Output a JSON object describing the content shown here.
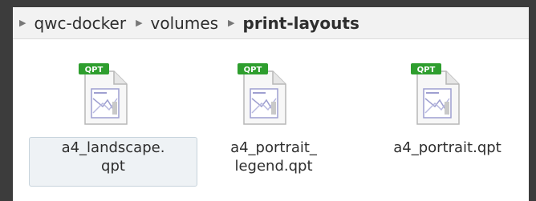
{
  "breadcrumb": {
    "items": [
      "qwc-docker",
      "volumes"
    ],
    "current": "print-layouts"
  },
  "files": [
    {
      "name": "a4_landscape.\nqpt",
      "badge": "QPT",
      "selected": true
    },
    {
      "name": "a4_portrait_\nlegend.qpt",
      "badge": "QPT",
      "selected": false
    },
    {
      "name": "a4_portrait.qpt",
      "badge": "QPT",
      "selected": false
    }
  ],
  "colors": {
    "badge": "#2e9e2e",
    "window_bg": "#ffffff",
    "frame_bg": "#3c3c3c"
  },
  "icons": {
    "breadcrumb_separator": "triangle-right-icon",
    "file": "qpt-file-icon"
  }
}
